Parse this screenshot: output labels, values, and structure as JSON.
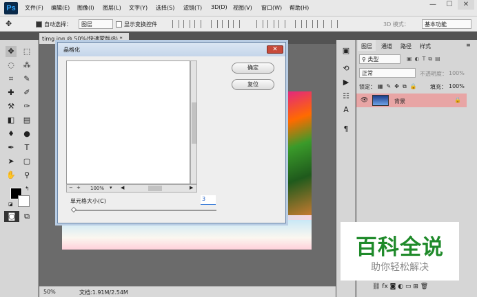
{
  "app": {
    "logo": "Ps"
  },
  "menu": [
    "文件(F)",
    "编辑(E)",
    "图像(I)",
    "图层(L)",
    "文字(Y)",
    "选择(S)",
    "滤镜(T)",
    "3D(D)",
    "视图(V)",
    "窗口(W)",
    "帮助(H)"
  ],
  "window_controls": {
    "minimize": "—",
    "maximize": "☐",
    "close": "✕"
  },
  "options": {
    "auto_select_label": "自动选择：",
    "auto_select_value": "图层",
    "transform_label": "显示变换控件",
    "mode_label": "3D 模式：",
    "workspace": "基本功能"
  },
  "document": {
    "tab": "timg.jpg @ 50%(快速蒙版/8) *",
    "close": "×",
    "zoom": "50%",
    "docinfo": "文档:1.91M/2.54M"
  },
  "dialog": {
    "title": "晶格化",
    "ok": "确定",
    "reset": "复位",
    "zoom": "100%",
    "zoom_minus": "−",
    "zoom_plus": "+",
    "cell_label": "单元格大小(C)",
    "cell_value": "3"
  },
  "layers_panel": {
    "tabs": [
      "图层",
      "通道",
      "路径",
      "样式"
    ],
    "filter": "类型",
    "blend": "正常",
    "opacity_label": "不透明度：",
    "opacity": "100%",
    "lock_label": "锁定：",
    "fill_label": "填充：",
    "fill": "100%",
    "layer_name": "背景"
  },
  "watermark": {
    "title": "百科全说",
    "subtitle": "助你轻松解决"
  },
  "colors": {
    "accent": "#31a8ff",
    "layer_selected": "#e8a5a5",
    "watermark_green": "#1f8a2a"
  }
}
